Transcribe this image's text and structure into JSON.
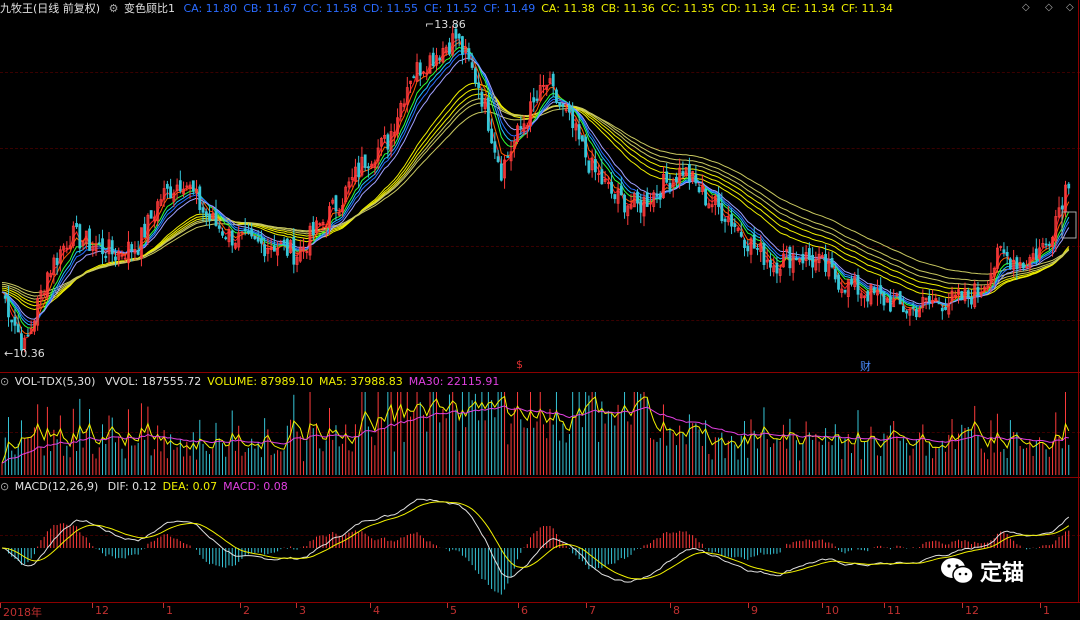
{
  "header": {
    "stock_title": "九牧王(日线 前复权)",
    "indicator_icon": "gear-icon",
    "indicator_name": "变色顾比1",
    "values": [
      {
        "label": "CA: 11.80",
        "color": "#2a6bff"
      },
      {
        "label": "CB: 11.67",
        "color": "#2a6bff"
      },
      {
        "label": "CC: 11.58",
        "color": "#2a6bff"
      },
      {
        "label": "CD: 11.55",
        "color": "#2a6bff"
      },
      {
        "label": "CE: 11.52",
        "color": "#2a6bff"
      },
      {
        "label": "CF: 11.49",
        "color": "#2a6bff"
      },
      {
        "label": "CA: 11.38",
        "color": "#f0f000"
      },
      {
        "label": "CB: 11.36",
        "color": "#f0f000"
      },
      {
        "label": "CC: 11.35",
        "color": "#f0f000"
      },
      {
        "label": "CD: 11.34",
        "color": "#f0f000"
      },
      {
        "label": "CE: 11.34",
        "color": "#f0f000"
      },
      {
        "label": "CF: 11.34",
        "color": "#f0f000"
      }
    ],
    "corner_icon": "diamond-icon"
  },
  "price_panel": {
    "high_label": "13.86",
    "low_label": "10.36",
    "event_markers": [
      {
        "text": "$",
        "color": "#e03030"
      },
      {
        "text": "财",
        "color": "#4a8cff"
      }
    ]
  },
  "volume_panel": {
    "indicator_name": "VOL-TDX(5,30)",
    "values": [
      {
        "label": "VVOL: 187555.72",
        "color": "#e0e0e0"
      },
      {
        "label": "VOLUME: 87989.10",
        "color": "#f0f000"
      },
      {
        "label": "MA5: 37988.83",
        "color": "#f0f000"
      },
      {
        "label": "MA30: 22115.91",
        "color": "#e040e0"
      }
    ]
  },
  "macd_panel": {
    "indicator_name": "MACD(12,26,9)",
    "values": [
      {
        "label": "DIF: 0.12",
        "color": "#e0e0e0"
      },
      {
        "label": "DEA: 0.07",
        "color": "#f0f000"
      },
      {
        "label": "MACD: 0.08",
        "color": "#e040e0"
      }
    ]
  },
  "x_axis": {
    "ticks": [
      "2018年",
      "12",
      "1",
      "2",
      "3",
      "4",
      "5",
      "6",
      "7",
      "8",
      "9",
      "10",
      "11",
      "12",
      "1"
    ]
  },
  "watermark": {
    "text": "定锚",
    "icon": "wechat-icon"
  },
  "chart_data": {
    "type": "candlestick",
    "price_range": [
      10.36,
      13.86
    ],
    "series_note_colors": {
      "up": "#ff3b3b",
      "down": "#36c6d8",
      "short_ma": "#2a6bff",
      "long_ma": "#f0f000"
    },
    "close_path": [
      11.0,
      10.4,
      11.2,
      11.6,
      11.5,
      11.4,
      11.5,
      12.0,
      12.2,
      11.8,
      11.6,
      11.5,
      11.5,
      11.4,
      11.7,
      12.0,
      12.4,
      12.6,
      13.3,
      13.5,
      13.7,
      13.2,
      12.3,
      12.8,
      13.2,
      12.8,
      12.3,
      12.0,
      11.9,
      12.1,
      12.3,
      12.0,
      11.8,
      11.5,
      11.3,
      11.4,
      11.3,
      11.1,
      11.0,
      10.9,
      10.8,
      10.9,
      10.9,
      11.0,
      11.4,
      11.3,
      11.5,
      12.2
    ]
  }
}
